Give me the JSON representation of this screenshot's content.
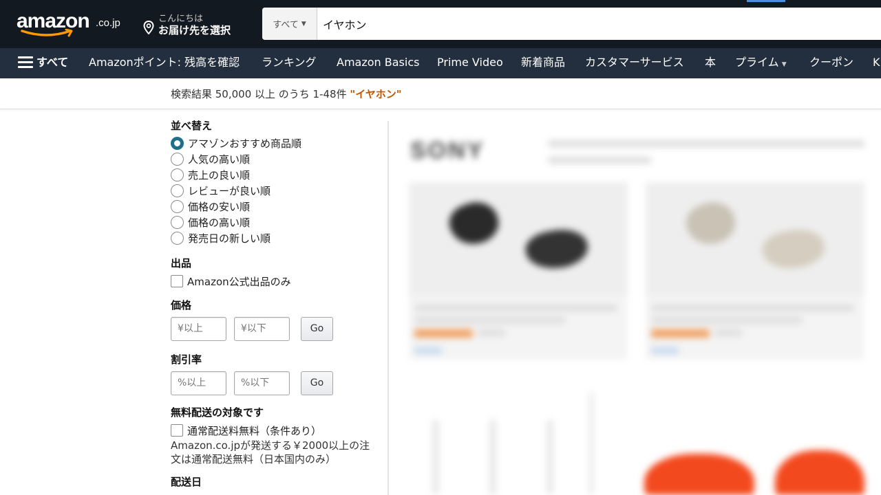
{
  "header": {
    "logo_text": "amazon",
    "logo_tld": ".co.jp",
    "deliver_line1": "こんにちは",
    "deliver_line2": "お届け先を選択",
    "search": {
      "category": "すべて",
      "query": "イヤホン"
    }
  },
  "subnav": {
    "all_label": "すべて",
    "items": [
      "Amazonポイント: 残高を確認",
      "ランキング",
      "Amazon Basics",
      "Prime Video",
      "新着商品",
      "カスタマーサービス",
      "本",
      "プライム",
      "クーポン",
      "K"
    ]
  },
  "results_info": {
    "prefix": "検索結果 50,000 以上 のうち 1-48件",
    "query": "\"イヤホン\""
  },
  "sidebar": {
    "sort_title": "並べ替え",
    "sort_options": [
      "アマゾンおすすめ商品順",
      "人気の高い順",
      "売上の良い順",
      "レビューが良い順",
      "価格の安い順",
      "価格の高い順",
      "発売日の新しい順"
    ],
    "sort_selected_index": 0,
    "seller_title": "出品",
    "seller_option": "Amazon公式出品のみ",
    "price_title": "価格",
    "price_min_placeholder": "¥以上",
    "price_max_placeholder": "¥以下",
    "go_label": "Go",
    "discount_title": "割引率",
    "discount_min_placeholder": "%以上",
    "discount_max_placeholder": "%以下",
    "shipping_title": "無料配送の対象です",
    "shipping_option": "通常配送料無料（条件あり）",
    "shipping_note": "Amazon.co.jpが発送する￥2000以上の注文は通常配送無料（日本国内のみ）",
    "next_title_partial": "配送日"
  },
  "results": {
    "brand_logo": "SONY"
  },
  "colors": {
    "nav_dark": "#131921",
    "subnav": "#232f3e",
    "query_accent": "#c45500",
    "radio_selected": "#1f6f8b",
    "smile": "#ff9900"
  }
}
